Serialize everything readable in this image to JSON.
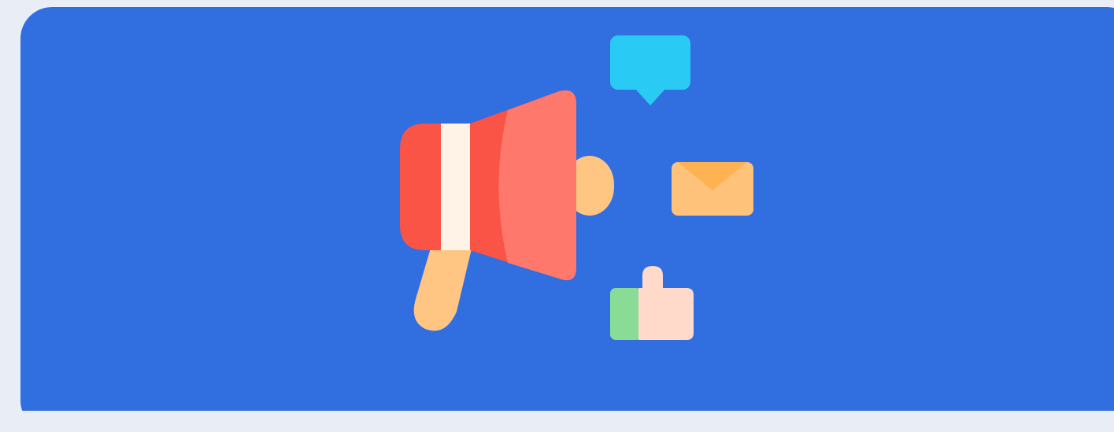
{
  "colors": {
    "page_background": "#e9edf6",
    "card_background": "#316ee0",
    "megaphone_red": "#fa5446",
    "megaphone_coral": "#ff786c",
    "megaphone_band": "#fff2e6",
    "handle_peach": "#ffc582",
    "chat_bubble": "#29cbf5",
    "envelope": "#ffc27a",
    "envelope_flap": "#ffb252",
    "thumb_green": "#88dc96",
    "thumb_skin": "#ffdacb"
  },
  "icons": [
    "megaphone-icon",
    "chat-bubble-icon",
    "envelope-icon",
    "thumbs-up-icon"
  ]
}
